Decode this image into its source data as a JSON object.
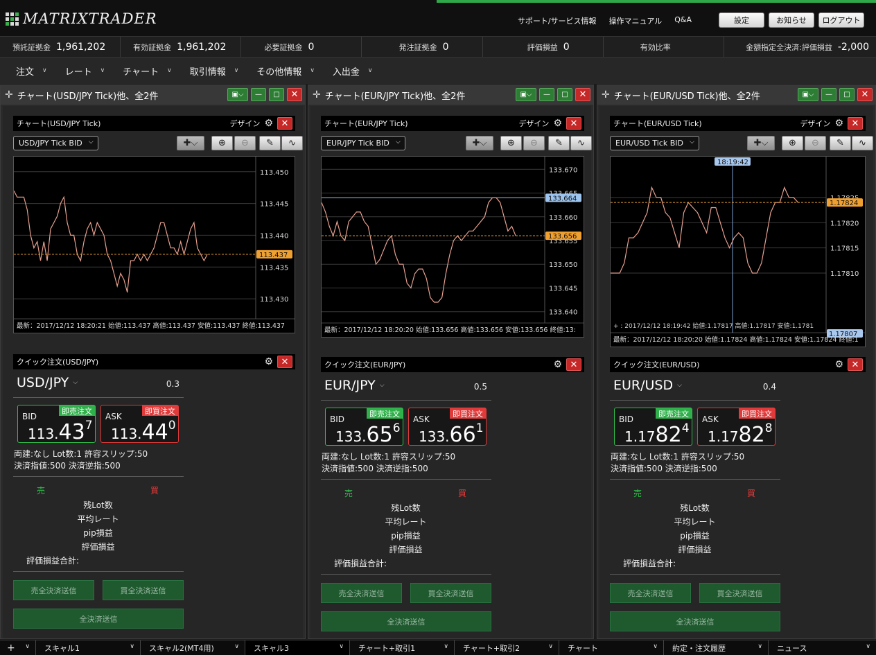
{
  "header": {
    "logo_text": "MATRIXTRADER",
    "links": [
      "サポート/サービス情報",
      "操作マニュアル",
      "Q&A"
    ],
    "buttons": [
      "設定",
      "お知らせ",
      "ログアウト"
    ]
  },
  "account": [
    {
      "label": "預託証拠金",
      "value": "1,961,202"
    },
    {
      "label": "有効証拠金",
      "value": "1,961,202"
    },
    {
      "label": "必要証拠金",
      "value": "0"
    },
    {
      "label": "発注証拠金",
      "value": "0"
    },
    {
      "label": "評価損益",
      "value": "0"
    },
    {
      "label": "有効比率",
      "value": ""
    },
    {
      "label": "金額指定全決済:評価損益",
      "value": "-2,000"
    }
  ],
  "menu": [
    "注文",
    "レート",
    "チャート",
    "取引情報",
    "その他情報",
    "入出金"
  ],
  "common": {
    "design": "デザイン",
    "uri": "売",
    "kai": "買",
    "bid": "BID",
    "ask": "ASK",
    "bid_tag": "即売注文",
    "ask_tag": "即買注文",
    "stats": [
      "残Lot数",
      "平均レート",
      "pip損益",
      "評価損益"
    ],
    "total": "評価損益合計:",
    "btn_sell_all": "売全決済送信",
    "btn_buy_all": "買全決済送信",
    "btn_all": "全決済送信"
  },
  "panels": [
    {
      "title": "チャート(USD/JPY Tick)他、全2件",
      "chart_title": "チャート(USD/JPY Tick)",
      "select": "USD/JPY Tick BID",
      "footer": "最新：2017/12/12 18:20:21  始値:113.437  高値:113.437  安値:113.437  終値:113.437",
      "current_label": "113.437",
      "quick_title": "クイック注文(USD/JPY)",
      "symbol": "USD/JPY",
      "spread": "0.3",
      "bid": {
        "p1": "113.",
        "p2": "43",
        "p3": "7"
      },
      "ask": {
        "p1": "113.",
        "p2": "44",
        "p3": "0"
      },
      "info1": "両建:なし  Lot数:1  許容スリップ:50",
      "info2": "決済指値:500  決済逆指:500"
    },
    {
      "title": "チャート(EUR/JPY Tick)他、全2件",
      "chart_title": "チャート(EUR/JPY Tick)",
      "select": "EUR/JPY Tick BID",
      "footer": "最新：2017/12/12 18:20:20  始値:133.656  高値:133.656  安値:133.656  終値:13:",
      "current_label": "133.656",
      "ask_label": "133.664",
      "quick_title": "クイック注文(EUR/JPY)",
      "symbol": "EUR/JPY",
      "spread": "0.5",
      "bid": {
        "p1": "133.",
        "p2": "65",
        "p3": "6"
      },
      "ask": {
        "p1": "133.",
        "p2": "66",
        "p3": "1"
      },
      "info1": "両建:なし  Lot数:1  許容スリップ:50",
      "info2": "決済指値:500  決済逆指:500"
    },
    {
      "title": "チャート(EUR/USD Tick)他、全2件",
      "chart_title": "チャート(EUR/USD Tick)",
      "select": "EUR/USD Tick BID",
      "footer": "最新：2017/12/12 18:20:20  始値:1.17824  高値:1.17824  安値:1.17824  終値:1",
      "crosshair_time": "18:19:42",
      "crosshair_info": "+ : 2017/12/12 18:19:42  始値:1.17817  高値:1.17817  安値:1.1781",
      "current_label": "1.17824",
      "cross_label": "1.17807",
      "quick_title": "クイック注文(EUR/USD)",
      "symbol": "EUR/USD",
      "spread": "0.4",
      "bid": {
        "p1": "1.17",
        "p2": "82",
        "p3": "4"
      },
      "ask": {
        "p1": "1.17",
        "p2": "82",
        "p3": "8"
      },
      "info1": "両建:なし  Lot数:1  許容スリップ:50",
      "info2": "決済指値:500  決済逆指:500"
    }
  ],
  "taskbar": [
    "スキャル1",
    "スキャル2(MT4用)",
    "スキャル3",
    "チャート+取引1",
    "チャート+取引2",
    "チャート",
    "約定・注文履歴",
    "ニュース"
  ],
  "colors": {
    "line": "#e8a090",
    "current": "#f0a030",
    "ask_line": "#9cc4ee",
    "grid": "#3a3a3a"
  },
  "chart_data": [
    {
      "type": "line",
      "ylim": [
        113.4275,
        113.4515
      ],
      "yticks": [
        113.45,
        113.445,
        113.44,
        113.435,
        113.43
      ],
      "current": 113.437,
      "values": [
        113.447,
        113.446,
        113.446,
        113.446,
        113.444,
        113.44,
        113.438,
        113.439,
        113.436,
        113.439,
        113.436,
        113.441,
        113.442,
        113.443,
        113.445,
        113.446,
        113.442,
        113.44,
        113.44,
        113.437,
        113.436,
        113.439,
        113.441,
        113.442,
        113.44,
        113.442,
        113.441,
        113.44,
        113.437,
        113.436,
        113.434,
        113.432,
        113.434,
        113.433,
        113.431,
        113.436,
        113.436,
        113.437,
        113.436,
        113.437,
        113.436,
        113.437,
        113.438,
        113.44,
        113.442,
        113.442,
        113.44,
        113.438,
        113.438,
        113.437,
        113.439,
        113.437,
        113.439,
        113.441,
        113.442,
        113.438,
        113.437,
        113.436,
        113.437
      ]
    },
    {
      "type": "line",
      "ylim": [
        133.6385,
        133.6715
      ],
      "yticks": [
        133.67,
        133.665,
        133.66,
        133.655,
        133.65,
        133.645,
        133.64
      ],
      "current": 133.656,
      "ask_line": 133.664,
      "values": [
        133.663,
        133.661,
        133.658,
        133.656,
        133.659,
        133.656,
        133.655,
        133.659,
        133.66,
        133.661,
        133.661,
        133.659,
        133.658,
        133.654,
        133.65,
        133.651,
        133.653,
        133.655,
        133.656,
        133.652,
        133.65,
        133.65,
        133.646,
        133.645,
        133.648,
        133.649,
        133.649,
        133.647,
        133.643,
        133.642,
        133.642,
        133.643,
        133.648,
        133.652,
        133.655,
        133.656,
        133.655,
        133.656,
        133.657,
        133.657,
        133.658,
        133.659,
        133.66,
        133.663,
        133.664,
        133.664,
        133.663,
        133.66,
        133.657,
        133.658,
        133.656
      ]
    },
    {
      "type": "line",
      "ylim": [
        1.17799,
        1.17832
      ],
      "yticks": [
        1.17825,
        1.1782,
        1.17815,
        1.1781
      ],
      "current": 1.17824,
      "cross_value": 1.17807,
      "values": [
        1.1781,
        1.1781,
        1.1781,
        1.17812,
        1.17817,
        1.17817,
        1.17818,
        1.1782,
        1.17822,
        1.17827,
        1.17825,
        1.17825,
        1.17822,
        1.17821,
        1.17818,
        1.17815,
        1.17822,
        1.17824,
        1.17823,
        1.17822,
        1.1782,
        1.17818,
        1.17823,
        1.17823,
        1.1782,
        1.17817,
        1.17815,
        1.17817,
        1.17818,
        1.17817,
        1.17812,
        1.1781,
        1.1781,
        1.17812,
        1.17817,
        1.17822,
        1.17824,
        1.17824,
        1.17827,
        1.17825,
        1.17825,
        1.17824
      ]
    }
  ]
}
